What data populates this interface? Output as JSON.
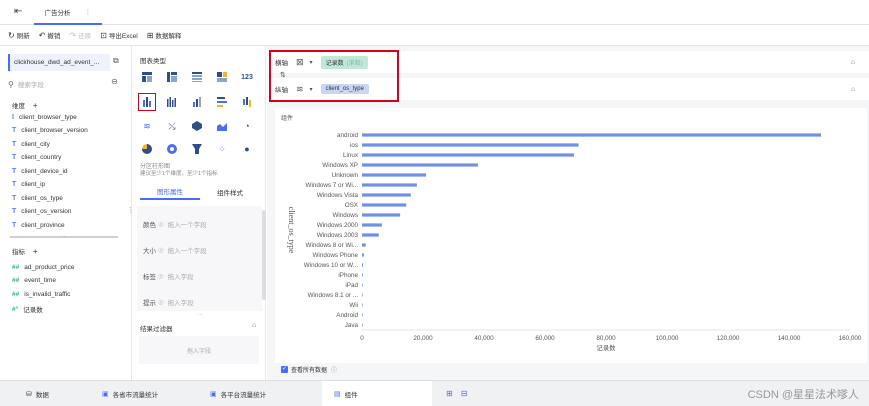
{
  "topbar": {
    "back_icon": "exit-icon",
    "tab_title": "广告分析",
    "more": "⋮"
  },
  "toolbar": {
    "refresh": "刷新",
    "undo": "撤销",
    "redo": "还原",
    "export_excel": "导出Excel",
    "data_explain": "数据解释"
  },
  "left": {
    "table_name": "clickhouse_dwd_ad_event_...",
    "search_placeholder": "搜索字段",
    "dimension_title": "维度",
    "dimensions": [
      "client_browser_type",
      "client_browser_version",
      "client_city",
      "client_country",
      "client_device_id",
      "client_ip",
      "client_os_type",
      "client_os_version",
      "client_province"
    ],
    "measure_title": "指标",
    "measures": [
      "ad_product_price",
      "event_time",
      "is_invalid_traffic",
      "记录数"
    ]
  },
  "middle": {
    "chart_type_title": "图表类型",
    "chart_desc_title": "分区柱形图",
    "chart_desc_hint": "建议至少1个维度，至少1个指标",
    "tab_props": "图形属性",
    "tab_style": "组件样式",
    "attrs": [
      {
        "label": "颜色",
        "placeholder": "拖入一个字段"
      },
      {
        "label": "大小",
        "placeholder": "拖入一个字段"
      },
      {
        "label": "标签",
        "placeholder": "拖入字段"
      },
      {
        "label": "提示",
        "placeholder": "拖入字段"
      }
    ],
    "filter_title": "结果过滤器",
    "filter_placeholder": "拖入字段"
  },
  "axes": {
    "x_label": "横轴",
    "x_field": "记录数",
    "x_field_sub": "(求和)",
    "y_label": "纵轴",
    "y_field": "client_os_type",
    "accent": "#d9001b"
  },
  "chart_area": {
    "component_label": "组件",
    "show_all_label": "查看所有数据"
  },
  "chart_data": {
    "type": "bar",
    "orientation": "horizontal",
    "categories": [
      "android",
      "ios",
      "Linux",
      "Windows XP",
      "Unknown",
      "Windows 7 or Wi...",
      "Windows Vista",
      "OSX",
      "Windows",
      "Windows 2000",
      "Windows 2003",
      "Windows 8 or Wi...",
      "Windows Phone",
      "Windows 10 or W...",
      "iPhone",
      "iPad",
      "Windows 8.1 or ...",
      "Wii",
      "Android",
      "Java"
    ],
    "values": [
      150500,
      71000,
      69500,
      38000,
      21000,
      18000,
      16000,
      14500,
      12500,
      6500,
      5500,
      1200,
      600,
      350,
      250,
      200,
      150,
      100,
      80,
      60
    ],
    "xlabel": "记录数",
    "ylabel": "client_os_type",
    "xlim": [
      0,
      160000
    ],
    "xticks": [
      "0",
      "20,000",
      "40,000",
      "60,000",
      "80,000",
      "100,000",
      "120,000",
      "140,000",
      "160,000"
    ],
    "bar_color": "#6f8fe8",
    "grid": false
  },
  "bottom": {
    "data_tab": "数据",
    "tabs": [
      "各省市流量统计",
      "各平台流量统计",
      "组件"
    ],
    "watermark": "CSDN @星星法术嗲人"
  }
}
